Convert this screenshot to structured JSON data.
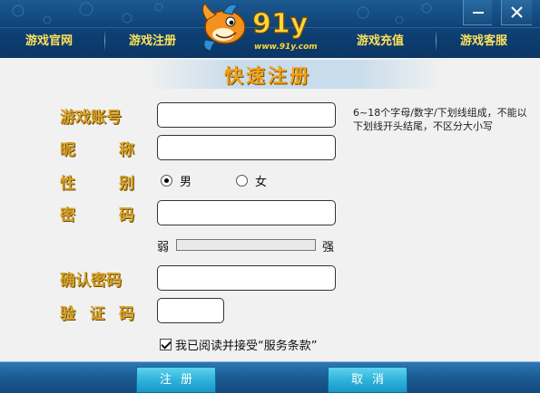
{
  "header": {
    "logo_text": "91y",
    "logo_url_text": "www.91y.com",
    "nav": [
      {
        "label": "游戏官网"
      },
      {
        "label": "游戏注册"
      },
      {
        "label": "游戏充值"
      },
      {
        "label": "游戏客服"
      }
    ],
    "minimize_icon": "minimize-icon",
    "close_icon": "close-icon"
  },
  "form": {
    "title": "快速注册",
    "account_label": "游戏账号",
    "account_value": "",
    "account_hint": "6~18个字母/数字/下划线组成，不能以下划线开头结尾，不区分大小写",
    "nickname_label_chars": [
      "昵",
      "称"
    ],
    "nickname_value": "",
    "gender_label_chars": [
      "性",
      "别"
    ],
    "gender_options": [
      {
        "label": "男",
        "checked": true
      },
      {
        "label": "女",
        "checked": false
      }
    ],
    "password_label_chars": [
      "密",
      "码"
    ],
    "password_value": "",
    "strength_weak": "弱",
    "strength_strong": "强",
    "strength_level": 0,
    "confirm_label": "确认密码",
    "confirm_value": "",
    "captcha_label_chars": [
      "验",
      "证",
      "码"
    ],
    "captcha_value": "",
    "agree_checked": true,
    "agree_text": "我已阅读并接受“服务条款”"
  },
  "footer": {
    "register_label": "注册",
    "cancel_label": "取消"
  },
  "colors": {
    "header_bg": "#0f4378",
    "nav_text": "#ffe15a",
    "label_gold": "#d7a128",
    "title_orange": "#f0a318",
    "button_cyan": "#2fb3db"
  }
}
